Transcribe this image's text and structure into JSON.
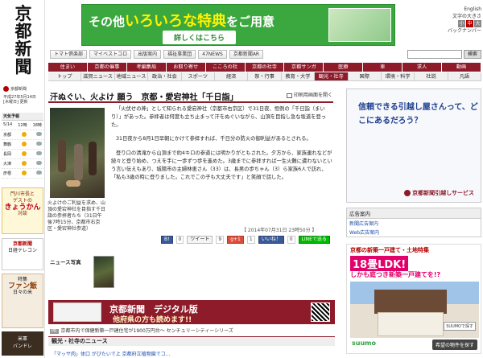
{
  "sidebar": {
    "logo": "京都新聞",
    "corp": "京都新聞",
    "date": "平成27年5月14日\n[木曜日] 更新",
    "weather": {
      "title": "天気予報",
      "head": [
        "5/14",
        "12時",
        "18時"
      ],
      "rows": [
        "京都",
        "舞鶴",
        "長岡",
        "大津",
        "彦根"
      ]
    },
    "ad1": {
      "line1": "門川市長と",
      "line2": "ゲストの",
      "big": "きょうかん",
      "line3": "対談"
    },
    "ad2": {
      "red": "京都新聞",
      "line": "日経テレコン"
    },
    "ad3": {
      "line1": "特集",
      "big": "ファン飯",
      "line2": "日々の米"
    },
    "ad4": {
      "line1": "米軍",
      "line2": "バンドレ"
    }
  },
  "top_banner": {
    "pre": "その他",
    "highlight": "いろいろな特典",
    "post": "をご用意",
    "cta": "詳しくはこちら"
  },
  "lang": {
    "english": "English",
    "size_label": "文字の大きさ",
    "sizes": [
      "小",
      "中",
      "大"
    ],
    "backnumber": "バックナンバー"
  },
  "util": {
    "buttons": [
      "トマト倶楽部",
      "マイベストコロ",
      "出版案内",
      "福祉事業団",
      "47NEWS",
      "京都新聞AR"
    ],
    "search_button": "検索"
  },
  "nav1": [
    "住まい",
    "京都の催事",
    "考編集局",
    "お取り寄せ",
    "こころの杜",
    "京都の社寺",
    "京都サンガ",
    "医療",
    "車",
    "求人",
    "動画"
  ],
  "nav2": [
    "トップ",
    "滋賀ニュース",
    "地域ニュース",
    "政治・社会",
    "スポーツ",
    "経済",
    "祭・行事",
    "教育・大学",
    "観光・社寺",
    "国際",
    "環境・科学",
    "社説",
    "凡語"
  ],
  "nav2_active": "観光・社寺",
  "article": {
    "title": "汗ぬぐい、火よけ 願う　京都・愛宕神社「千日詣」",
    "print": "印刷用画面を開く",
    "paragraphs": [
      "「火伏せの神」として知られる愛宕神社（京都市右京区）で31日夜、恒例の「千日詣（まいり）」があった。参拝者は何度も立ち止まって汗をぬぐいながら、山頂を目指し急な坂道を登った。",
      "31日夜から8月1日早朝にかけて参拝すれば、千日分の防火の御利益があるとされる。",
      "登り口の清滝から山頂まで約4キロの参道には明かりがともされた。夕方から、家族連れなどが続々と登り始め、つえを手に一歩ずつ歩を進めた。3歳までに参拝すれば一生火難に遭わないという言い伝えもあり、城陽市の主婦林恵さん（33）は、長男の歩ちゃん（3）ら家族6人で訪れ、「私も3歳の時に登りました。これでこの子も大丈夫です」と笑顔で話した。"
    ],
    "caption": "火よけのご利益を求め、山頂の愛宕神社を目指す千日詣の参拝者たち（31日午後7時15分、京都市右京区・愛宕神社参道）",
    "timestamp": "【 2014年07月31日 23時50分 】",
    "share": {
      "b": "B!",
      "b_count": "0",
      "tweet": "ツイート",
      "tweet_count": "9",
      "gplus": "g+1",
      "gplus_count": "1",
      "like": "いいね！",
      "like_count": "0",
      "line": "LINEで送る"
    },
    "news_photo_label": "ニュース写真"
  },
  "digital_banner": {
    "title": "京都新聞　デジタル版",
    "sub": "他府県の方も読めます!!"
  },
  "pr": {
    "tag": "PR",
    "text": "京都市内で保健新築一戸建住宅が1900万円台～ センチュリーシティーシリーズ"
  },
  "section": {
    "title": "観光・社寺のニュース",
    "item": "「マッサ肉」体口 がびたいで上 京都府立植物園でコ..."
  },
  "right": {
    "radbox": {
      "text": "信頼できる引越し屋さんって、どこにあるだろう？",
      "logo": "京都新聞引越しサービス"
    },
    "adlist": {
      "title": "広告案内",
      "items": [
        "新聞広告案内",
        "Web広告案内"
      ]
    },
    "suumo": {
      "h1": "京都の新築一戸建て・土地特集",
      "h2": "18畳LDK!",
      "h3": "しかも庭つき新築一戸建てを!?",
      "brand": "suumo",
      "cta": "希望の物件を探す",
      "badge": "SUUMOで探す"
    }
  }
}
